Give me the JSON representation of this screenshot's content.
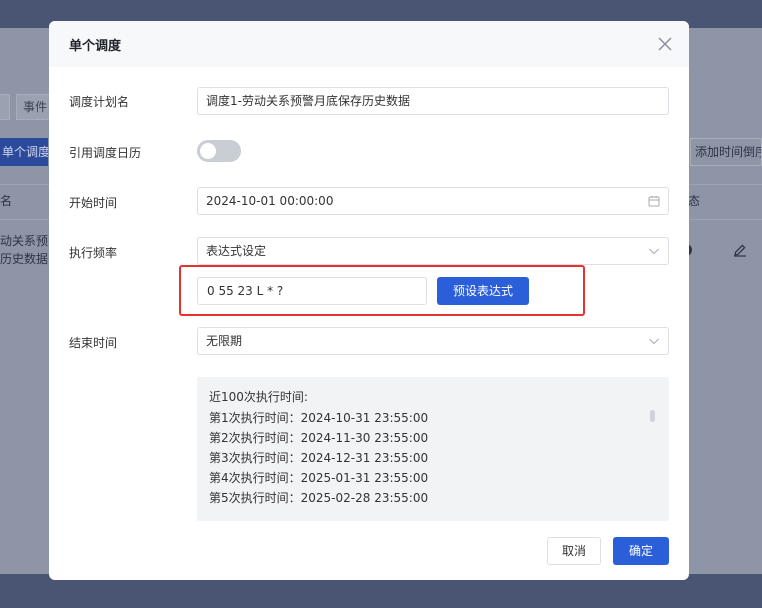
{
  "background": {
    "tabs": [
      "",
      "事件"
    ],
    "primary_button": "单个调度",
    "right_button": "添加时间倒序",
    "column_name": "名",
    "column_state": "态",
    "row_name_line1": "动关系预",
    "row_name_line2": "历史数据"
  },
  "modal": {
    "title": "单个调度",
    "close_icon": "close-icon",
    "fields": {
      "plan_name": {
        "label": "调度计划名",
        "value": "调度1-劳动关系预警月底保存历史数据"
      },
      "use_calendar": {
        "label": "引用调度日历",
        "enabled": false
      },
      "start_time": {
        "label": "开始时间",
        "value": "2024-10-01 00:00:00",
        "icon": "calendar-icon"
      },
      "frequency": {
        "label": "执行频率",
        "value": "表达式设定",
        "icon": "chevron-down-icon"
      },
      "cron": {
        "value": "0 55 23 L * ?",
        "preset_button": "预设表达式"
      },
      "end_time": {
        "label": "结束时间",
        "value": "无限期",
        "icon": "chevron-down-icon"
      }
    },
    "preview": {
      "title": "近100次执行时间:",
      "rows": [
        "第1次执行时间：2024-10-31 23:55:00",
        "第2次执行时间：2024-11-30 23:55:00",
        "第3次执行时间：2024-12-31 23:55:00",
        "第4次执行时间：2025-01-31 23:55:00",
        "第5次执行时间：2025-02-28 23:55:00"
      ]
    },
    "footer": {
      "cancel": "取消",
      "confirm": "确定"
    }
  },
  "colors": {
    "primary": "#2b5fd9",
    "highlight": "#e8322f",
    "overlay": "#4a5573"
  }
}
